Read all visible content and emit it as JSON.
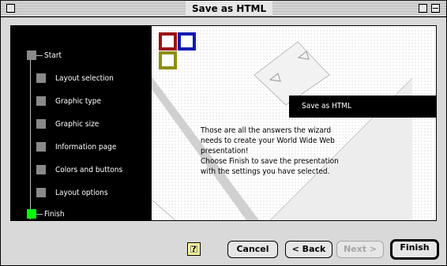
{
  "window": {
    "title": "Save as HTML"
  },
  "steps": [
    {
      "label": "Start",
      "state": "done"
    },
    {
      "label": "Layout selection",
      "state": "pending"
    },
    {
      "label": "Graphic type",
      "state": "pending"
    },
    {
      "label": "Graphic size",
      "state": "pending"
    },
    {
      "label": "Information page",
      "state": "pending"
    },
    {
      "label": "Colors and buttons",
      "state": "pending"
    },
    {
      "label": "Layout options",
      "state": "pending"
    },
    {
      "label": "Finish",
      "state": "current"
    }
  ],
  "stage": {
    "banner": "Save as HTML",
    "message_lines": [
      "Those are all the answers the wizard",
      "needs to create your World Wide Web",
      "presentation!",
      "Choose Finish to save the presentation",
      "with the settings you have selected."
    ]
  },
  "buttons": {
    "help": "?",
    "cancel": "Cancel",
    "back": "< Back",
    "next": "Next >",
    "finish": "Finish",
    "next_enabled": false
  },
  "colors": {
    "current_step": "#00ff00",
    "step_marker": "#8a8a8a",
    "logo_red": "#9b1111",
    "logo_blue": "#0b1bb3",
    "logo_olive": "#8e8e0f"
  },
  "icons": [
    "close-box-icon",
    "zoom-box-icon",
    "collapse-box-icon",
    "help-icon"
  ]
}
